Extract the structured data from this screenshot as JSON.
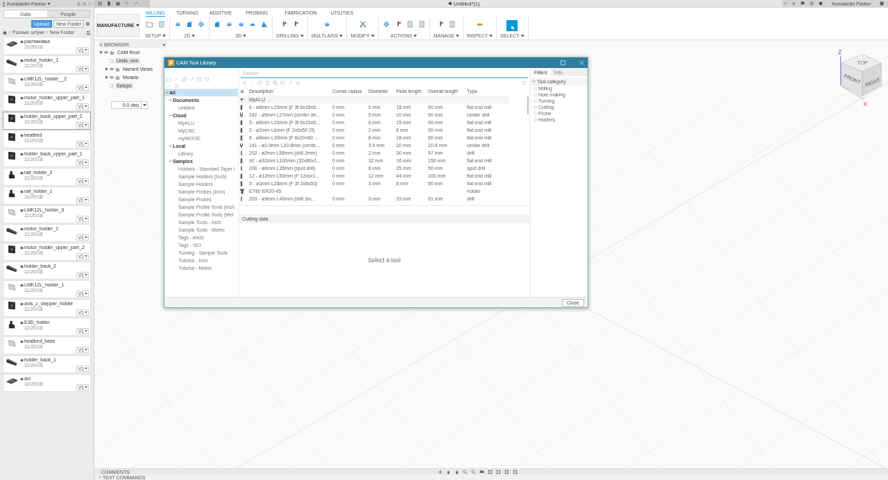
{
  "app_bar": {
    "user": "Konstantin Pavlov",
    "document_title": "Untitled*(1)",
    "account": "Konstantin Pavlov"
  },
  "data_panel": {
    "tabs": [
      {
        "label": "Data",
        "selected": true
      },
      {
        "label": "People",
        "selected": false
      }
    ],
    "upload": "Upload",
    "new_folder": "New Folder",
    "breadcrumb": [
      "Разные штуки",
      "New Folder"
    ],
    "files": [
      {
        "name": "распаковка",
        "date": "11/20/18",
        "version": "V1",
        "selected": false,
        "kind": "board"
      },
      {
        "name": "motor_holder_1",
        "date": "11/20/18",
        "version": "V1",
        "selected": false,
        "kind": "wedge"
      },
      {
        "name": "LMK12L_holder__2",
        "date": "11/20/18",
        "version": "V1",
        "selected": false,
        "kind": "plate"
      },
      {
        "name": "motor_holder_upper_part_1",
        "date": "11/20/18",
        "version": "V1",
        "selected": false,
        "kind": "square"
      },
      {
        "name": "holder_back_upper_part_2",
        "date": "11/20/18",
        "version": "V1",
        "selected": true,
        "kind": "square"
      },
      {
        "name": "heatbed",
        "date": "11/20/18",
        "version": "V1",
        "selected": false,
        "kind": "square"
      },
      {
        "name": "holder_back_upper_part_1",
        "date": "11/20/18",
        "version": "V1",
        "selected": false,
        "kind": "square"
      },
      {
        "name": "rail_holder_2",
        "date": "11/20/18",
        "version": "V1",
        "selected": false,
        "kind": "bracket"
      },
      {
        "name": "rail_holder_1",
        "date": "11/20/18",
        "version": "V1",
        "selected": false,
        "kind": "bracket"
      },
      {
        "name": "LMK12L_holder_3",
        "date": "11/20/18",
        "version": "V1",
        "selected": false,
        "kind": "plate"
      },
      {
        "name": "motor_holder_2",
        "date": "11/20/18",
        "version": "V1",
        "selected": false,
        "kind": "wedge"
      },
      {
        "name": "motor_holder_upper_part_2",
        "date": "11/20/18",
        "version": "V1",
        "selected": false,
        "kind": "square"
      },
      {
        "name": "holder_back_2",
        "date": "11/20/18",
        "version": "V1",
        "selected": false,
        "kind": "wedge"
      },
      {
        "name": "LMK12L_holder_1",
        "date": "11/20/18",
        "version": "V1",
        "selected": false,
        "kind": "plate"
      },
      {
        "name": "axis_z_stepper_holder",
        "date": "11/20/18",
        "version": "V1",
        "selected": false,
        "kind": "square"
      },
      {
        "name": "E3D_holder",
        "date": "11/20/18",
        "version": "V1",
        "selected": false,
        "kind": "bracket"
      },
      {
        "name": "heatbed_base",
        "date": "11/20/18",
        "version": "V1",
        "selected": false,
        "kind": "plate"
      },
      {
        "name": "holder_back_1",
        "date": "11/20/18",
        "version": "V1",
        "selected": false,
        "kind": "wedge"
      },
      {
        "name": "arc",
        "date": "11/20/18",
        "version": "V1",
        "selected": false,
        "kind": "board"
      }
    ]
  },
  "toolbar": {
    "workspace": "MANUFACTURE",
    "tabs": [
      {
        "label": "MILLING",
        "selected": true
      },
      {
        "label": "TURNING",
        "selected": false
      },
      {
        "label": "ADDITIVE",
        "selected": false
      },
      {
        "label": "PROBING",
        "selected": false
      },
      {
        "label": "FABRICATION",
        "selected": false
      },
      {
        "label": "UTILITIES",
        "selected": false
      }
    ],
    "groups": [
      {
        "label": "SETUP",
        "tools": [
          {
            "kind": "folder"
          },
          {
            "kind": "sheet"
          }
        ]
      },
      {
        "label": "2D",
        "tools": [
          {
            "kind": "layers"
          },
          {
            "kind": "box"
          },
          {
            "kind": "diamond"
          }
        ]
      },
      {
        "label": "3D",
        "tools": [
          {
            "kind": "box"
          },
          {
            "kind": "layers"
          },
          {
            "kind": "layers"
          },
          {
            "kind": "dome"
          },
          {
            "kind": "cone"
          }
        ]
      },
      {
        "label": "DRILLING",
        "tools": [
          {
            "kind": "drill"
          },
          {
            "kind": "drill"
          }
        ]
      },
      {
        "label": "MULTI-AXIS",
        "tools": [
          {
            "kind": "layers"
          }
        ]
      },
      {
        "label": "MODIFY",
        "tools": [
          {
            "kind": "scissors"
          }
        ]
      },
      {
        "label": "ACTIONS",
        "tools": [
          {
            "kind": "diamond"
          },
          {
            "kind": "drill"
          },
          {
            "kind": "sheet"
          },
          {
            "kind": "sheet"
          }
        ]
      },
      {
        "label": "MANAGE",
        "tools": [
          {
            "kind": "drill"
          },
          {
            "kind": "sheet"
          }
        ]
      },
      {
        "label": "INSPECT",
        "tools": [
          {
            "kind": "ruler"
          }
        ]
      },
      {
        "label": "SELECT",
        "tools": [
          {
            "kind": "cursor"
          }
        ]
      }
    ]
  },
  "browser": {
    "title": "BROWSER",
    "items": [
      {
        "label": "CAM Root",
        "expanded": true,
        "children": [
          {
            "label": "Units: mm"
          },
          {
            "label": "Named Views",
            "expanded": false
          },
          {
            "label": "Models",
            "expanded": false
          },
          {
            "label": "Setups"
          }
        ]
      }
    ]
  },
  "angle_field": {
    "value": "0.0 deg"
  },
  "view_cube": {
    "top": "TOP",
    "front": "FRONT",
    "right": "RIGHT",
    "z": "Z",
    "x": "X"
  },
  "tool_library": {
    "title": "CAM Tool Library",
    "search": {
      "placeholder": "Search"
    },
    "libraries": [
      {
        "label": "All",
        "selected": true,
        "expanded": true,
        "children": [
          {
            "label": "Documents",
            "selected": false,
            "expanded": true,
            "children": [
              {
                "label": "Untitled",
                "selected": false
              }
            ]
          },
          {
            "label": "Cloud",
            "selected": false,
            "expanded": true,
            "children": [
              {
                "label": "MyALU",
                "selected": false
              },
              {
                "label": "MyCNC",
                "selected": false
              },
              {
                "label": "myWOOD",
                "selected": false
              }
            ]
          },
          {
            "label": "Local",
            "selected": false,
            "expanded": true,
            "children": [
              {
                "label": "Library",
                "selected": false
              }
            ]
          },
          {
            "label": "Samples",
            "selected": false,
            "expanded": true,
            "children": [
              {
                "label": "Holders - Standard Taper I",
                "selected": false
              },
              {
                "label": "Sample Holders (Inch)",
                "selected": false
              },
              {
                "label": "Sample Holders",
                "selected": false
              },
              {
                "label": "Sample Probes (Inch)",
                "selected": false
              },
              {
                "label": "Sample Probes",
                "selected": false
              },
              {
                "label": "Sample Profile Tools (Inch",
                "selected": false
              },
              {
                "label": "Sample Profile Tools (Met",
                "selected": false
              },
              {
                "label": "Sample Tools - Inch",
                "selected": false
              },
              {
                "label": "Sample Tools - Metric",
                "selected": false
              },
              {
                "label": "Tags - ANSI",
                "selected": false
              },
              {
                "label": "Tags - ISO",
                "selected": false
              },
              {
                "label": "Turning - Sample Tools",
                "selected": false
              },
              {
                "label": "Tutorial - Inch",
                "selected": false
              },
              {
                "label": "Tutorial - Metric",
                "selected": false
              }
            ]
          }
        ]
      }
    ],
    "table": {
      "columns": [
        "Description",
        "Corner radius",
        "Diameter",
        "Flute length",
        "Overall length",
        "Type"
      ],
      "group": "MyALU",
      "rows": [
        {
          "kind": "endmill",
          "cells": [
            "6 - ø6mm L25mm (F 3f 6x18x6...",
            "0 mm",
            "6 mm",
            "18 mm",
            "60 mm",
            "flat end mill"
          ]
        },
        {
          "kind": "centerdrill",
          "cells": [
            "242 - ø5mm L27mm (center dri...",
            "0 mm",
            "5 mm",
            "10 mm",
            "50 mm",
            "center drill"
          ]
        },
        {
          "kind": "endmill",
          "cells": [
            "5 - ø6mm L20mm (F 3f 6x15x5...",
            "0 mm",
            "6 mm",
            "15 mm",
            "50 mm",
            "flat end mill"
          ]
        },
        {
          "kind": "endmill",
          "cells": [
            "2 - ø2mm L6mm (F 2x6x50 2f)",
            "0 mm",
            "2 mm",
            "6 mm",
            "50 mm",
            "flat end mill"
          ]
        },
        {
          "kind": "endmill",
          "cells": [
            "8 - ø8mm L30mm (F 8x20x60 ...",
            "0 mm",
            "8 mm",
            "18 mm",
            "60 mm",
            "flat end mill"
          ]
        },
        {
          "kind": "centerdrill",
          "cells": [
            "241 - ø3.9mm L20.8mm (cente...",
            "0 mm",
            "3.9 mm",
            "10 mm",
            "20.8 mm",
            "center drill"
          ]
        },
        {
          "kind": "drill",
          "cells": [
            "202 - ø2mm L58mm (drill 2mm)",
            "0 mm",
            "2 mm",
            "30 mm",
            "57 mm",
            "drill"
          ]
        },
        {
          "kind": "endmill",
          "cells": [
            "92 - ø32mm L100mm (32x80x1...",
            "0 mm",
            "32 mm",
            "16 mm",
            "150 mm",
            "flat end mill"
          ]
        },
        {
          "kind": "drill",
          "cells": [
            "200 - ø6mm L35mm (spot drill)",
            "0 mm",
            "6 mm",
            "25 mm",
            "50 mm",
            "spot drill"
          ]
        },
        {
          "kind": "endmill",
          "cells": [
            "12 - ø12mm L50mm (F 12xxx1...",
            "0 mm",
            "12 mm",
            "44 mm",
            "100 mm",
            "flat end mill"
          ]
        },
        {
          "kind": "endmill",
          "cells": [
            "3 - ø3mm L28mm (F 3f 3x8x50)",
            "0 mm",
            "3 mm",
            "8 mm",
            "50 mm",
            "flat end mill"
          ]
        },
        {
          "kind": "holder",
          "cells": [
            "ET80 ER20-45",
            null,
            null,
            null,
            null,
            "holder"
          ]
        },
        {
          "kind": "drill",
          "cells": [
            "203 - ø3mm L40mm (drill 3m...",
            "0 mm",
            "3 mm",
            "33 mm",
            "61 mm",
            "drill"
          ]
        }
      ]
    },
    "cutting_data": "Cutting data",
    "empty_message": "Select a tool",
    "side_tabs": [
      {
        "label": "Filters",
        "selected": true
      },
      {
        "label": "Info",
        "selected": false
      }
    ],
    "filter": {
      "label": "Tool category",
      "expanded": true,
      "options": [
        {
          "label": "Milling",
          "checked": false
        },
        {
          "label": "Hole making",
          "checked": false
        },
        {
          "label": "Turning",
          "checked": false
        },
        {
          "label": "Cutting",
          "checked": false
        },
        {
          "label": "Probe",
          "checked": false
        },
        {
          "label": "Holders",
          "checked": false
        }
      ]
    },
    "close": "Close"
  },
  "comments": "COMMENTS",
  "text_commands": "TEXT COMMANDS"
}
